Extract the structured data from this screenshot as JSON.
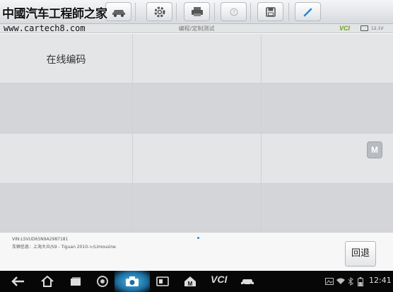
{
  "watermark": {
    "site_name": "中國汽车工程師之家",
    "url": "www.cartech8.com"
  },
  "header": {
    "title": "编程/定制测试",
    "vci_label": "VCI",
    "voltage": "12.1V"
  },
  "grid": {
    "cells": [
      "在线编码",
      "",
      "",
      "",
      "",
      "",
      "",
      "",
      "",
      "",
      "",
      ""
    ]
  },
  "side": {
    "m_label": "M"
  },
  "footer": {
    "vin": "VIN:LSVUD65N9A2987181",
    "vehicle_info": "车辆信息：上海大众/S9 - Tiguan 2010->/Limousine",
    "back_label": "回退"
  },
  "navbar": {
    "vci_label": "VCI",
    "clock": "12:41"
  },
  "colors": {
    "accent_green": "#6aa51f",
    "accent_blue": "#2b85d6",
    "navbar_bg": "#070707"
  },
  "toolbar_icons": [
    "car-icon",
    "settings-icon",
    "printer-icon",
    "help-icon",
    "save-icon",
    "edit-icon"
  ],
  "nav_icons": [
    "back-icon",
    "home-icon",
    "recent-apps-icon",
    "chrome-icon",
    "camera-icon",
    "screen-icon",
    "maxifix-icon",
    "vci-icon",
    "car-icon",
    "gallery-icon",
    "wifi-icon",
    "battery-icon"
  ]
}
